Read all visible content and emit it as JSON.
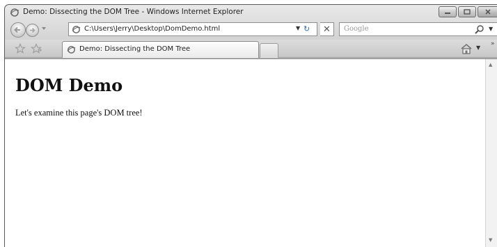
{
  "window": {
    "title": "Demo: Dissecting the DOM Tree - Windows Internet Explorer"
  },
  "address_bar": {
    "url": "C:\\Users\\Jerry\\Desktop\\DomDemo.html"
  },
  "search": {
    "placeholder": "Google"
  },
  "tabs": [
    {
      "label": "Demo: Dissecting the DOM Tree",
      "active": true
    }
  ],
  "page": {
    "heading": "DOM Demo",
    "paragraph": "Let's examine this page's DOM tree!"
  },
  "icons": {
    "title": "ie-page-icon",
    "back": "back-arrow-icon",
    "forward": "forward-arrow-icon",
    "refresh": "refresh-icon",
    "stop": "stop-icon",
    "search": "search-icon",
    "favorites": "favorites-star-icon",
    "add_favorite": "add-favorite-icon",
    "home": "home-icon"
  }
}
